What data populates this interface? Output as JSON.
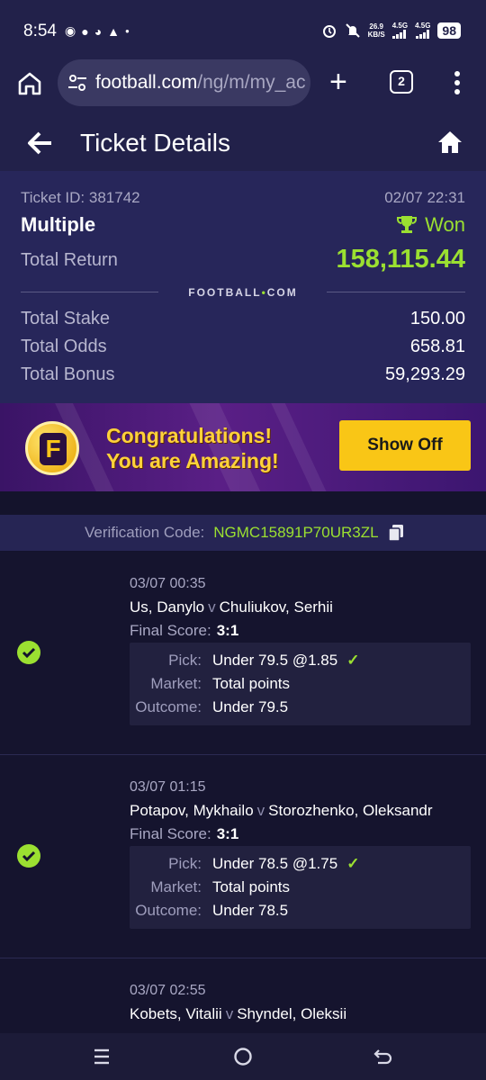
{
  "status_bar": {
    "time": "8:54",
    "net_speed_top": "26.9",
    "net_speed_bottom": "KB/S",
    "signal_1": "4.5G",
    "signal_2": "4.5G",
    "battery": "98"
  },
  "browser": {
    "url_host": "football.com",
    "url_path": "/ng/m/my_ac",
    "tab_count": "2"
  },
  "header": {
    "title": "Ticket Details"
  },
  "ticket": {
    "id_label": "Ticket ID: 381742",
    "date": "02/07 22:31",
    "type": "Multiple",
    "status": "Won",
    "total_return_label": "Total Return",
    "total_return_value": "158,115.44",
    "brand": "FOOTBALL",
    "brand_suffix": "COM",
    "rows": [
      {
        "label": "Total Stake",
        "value": "150.00"
      },
      {
        "label": "Total Odds",
        "value": "658.81"
      },
      {
        "label": "Total Bonus",
        "value": "59,293.29"
      }
    ]
  },
  "promo": {
    "line1": "Congratulations!",
    "line2": "You are Amazing!",
    "button": "Show Off",
    "logo_letter": "F"
  },
  "verification": {
    "label": "Verification Code:",
    "code": "NGMC15891P70UR3ZL"
  },
  "selections": [
    {
      "date": "03/07 00:35",
      "home": "Us, Danylo",
      "vs": "v",
      "away": "Chuliukov, Serhii",
      "score_label": "Final Score:",
      "score": "3:1",
      "pick_label": "Pick:",
      "pick": "Under 79.5 @1.85",
      "market_label": "Market:",
      "market": "Total points",
      "outcome_label": "Outcome:",
      "outcome": "Under 79.5"
    },
    {
      "date": "03/07 01:15",
      "home": "Potapov, Mykhailo",
      "vs": "v",
      "away": "Storozhenko, Oleksandr",
      "score_label": "Final Score:",
      "score": "3:1",
      "pick_label": "Pick:",
      "pick": "Under 78.5 @1.75",
      "market_label": "Market:",
      "market": "Total points",
      "outcome_label": "Outcome:",
      "outcome": "Under 78.5"
    },
    {
      "date": "03/07 02:55",
      "home": "Kobets, Vitalii",
      "vs": "v",
      "away": "Shyndel, Oleksii"
    }
  ],
  "colors": {
    "accent_green": "#9be031",
    "promo_gold": "#f9c616",
    "header_bg": "#22214a",
    "summary_bg": "#27265a"
  }
}
